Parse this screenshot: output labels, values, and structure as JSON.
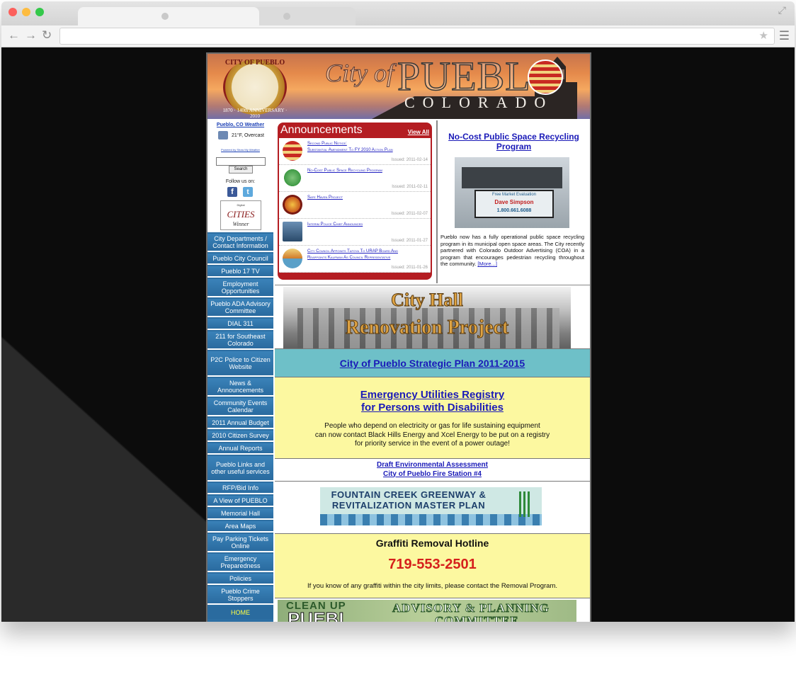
{
  "announcements": {
    "header": "Announcements",
    "view_all": "View All",
    "items": [
      {
        "title_line1": "Second Public Notice:",
        "title_line2": "Substantial Amendment To FY 2010 Action Plan",
        "date": "Issued: 2011-02-14"
      },
      {
        "title_line1": "No-Cost Public Space Recycling Program",
        "title_line2": "",
        "date": "Issued: 2011-02-11"
      },
      {
        "title_line1": "Safe Haven Project",
        "title_line2": "",
        "date": "Issued: 2011-02-07"
      },
      {
        "title_line1": "Interim Police Chief Announced",
        "title_line2": "",
        "date": "Issued: 2011-01-27"
      },
      {
        "title_line1": "City Council Appoints Tafoya To URAP Board And",
        "title_line2": "Reappoints Kaufman As Council Representative",
        "date": "Issued: 2011-01-26"
      }
    ]
  },
  "banner": {
    "seal_top": "CITY OF PUEBLO",
    "seal_bottom": "1870 · 140th ANNIVERSARY · 2010",
    "city_of": "City of",
    "pueblo": "PUEBL",
    "colorado": "COLORADO"
  },
  "sidebar": {
    "weather_title": "Pueblo, CO Weather",
    "weather_text": "21°F, Overcast",
    "weather_link": "Powered by Show My Weather",
    "search_label": "Search",
    "follow_label": "Follow us on:",
    "award_line1": "Digital",
    "award_line2": "CITIES",
    "award_line3": "Winner",
    "nav": [
      "City Departments / Contact Information",
      "Pueblo City Council",
      "Pueblo 17 TV",
      "Employment Opportunities",
      "Pueblo ADA Advisory Committee",
      "DIAL 311",
      "211 for Southeast Colorado",
      "P2C Police to Citizen Website",
      "News & Announcements",
      "Community Events Calendar",
      "2011 Annual Budget",
      "2010 Citizen Survey",
      "Annual Reports",
      "Pueblo Links and other useful services",
      "RFP/Bid Info",
      "A View of PUEBLO",
      "Memorial Hall",
      "Area Maps",
      "Pay Parking Tickets Online",
      "Emergency Preparedness",
      "Policies",
      "Pueblo Crime Stoppers",
      "HOME"
    ]
  },
  "recycling": {
    "title": "No-Cost Public Space Recycling Program",
    "billboard_line1": "Free Market Evaluation",
    "billboard_line2": "Dave Simpson",
    "billboard_line3": "1.800.661.6088",
    "text": "Pueblo now has a fully operational public space recycling program in its municipal open space areas. The City recently partnered with Colorado Outdoor Advertising (COA) in a program that encourages pedestrian recycling throughout the community.",
    "more": "[More...]"
  },
  "city_hall": {
    "line1": "City Hall",
    "line2": "Renovation Project"
  },
  "strategic_plan": "City of Pueblo Strategic Plan 2011-2015",
  "emergency": {
    "link_line1": "Emergency Utilities Registry",
    "link_line2": "for Persons with Disabilities",
    "text_line1": "People who depend on electricity or gas for life sustaining equipment",
    "text_line2": "can now contact Black Hills Energy and Xcel Energy to be put on a registry",
    "text_line3": "for priority service in the event of a power outage!"
  },
  "draft": {
    "line1": "Draft Environmental Assessment",
    "line2": "City of Pueblo Fire Station #4"
  },
  "fountain": {
    "line1": "FOUNTAIN CREEK GREENWAY &",
    "line2": "REVITALIZATION MASTER PLAN"
  },
  "graffiti": {
    "title": "Graffiti Removal Hotline",
    "phone": "719-553-2501",
    "text": "If you know of any graffiti within the city limits, please contact the Removal Program."
  },
  "cleanup": {
    "clean_up": "CLEAN UP",
    "pueblo": "PUEBL",
    "advisory": "ADVISORY & PLANNING",
    "committee": "COMMITTEE"
  },
  "colors": {
    "accent_red": "#b41d22",
    "nav_blue": "#2e74aa",
    "link_blue": "#1a1ab8",
    "yellow_panel": "#fcf8a0",
    "teal_panel": "#6ec0c8"
  }
}
